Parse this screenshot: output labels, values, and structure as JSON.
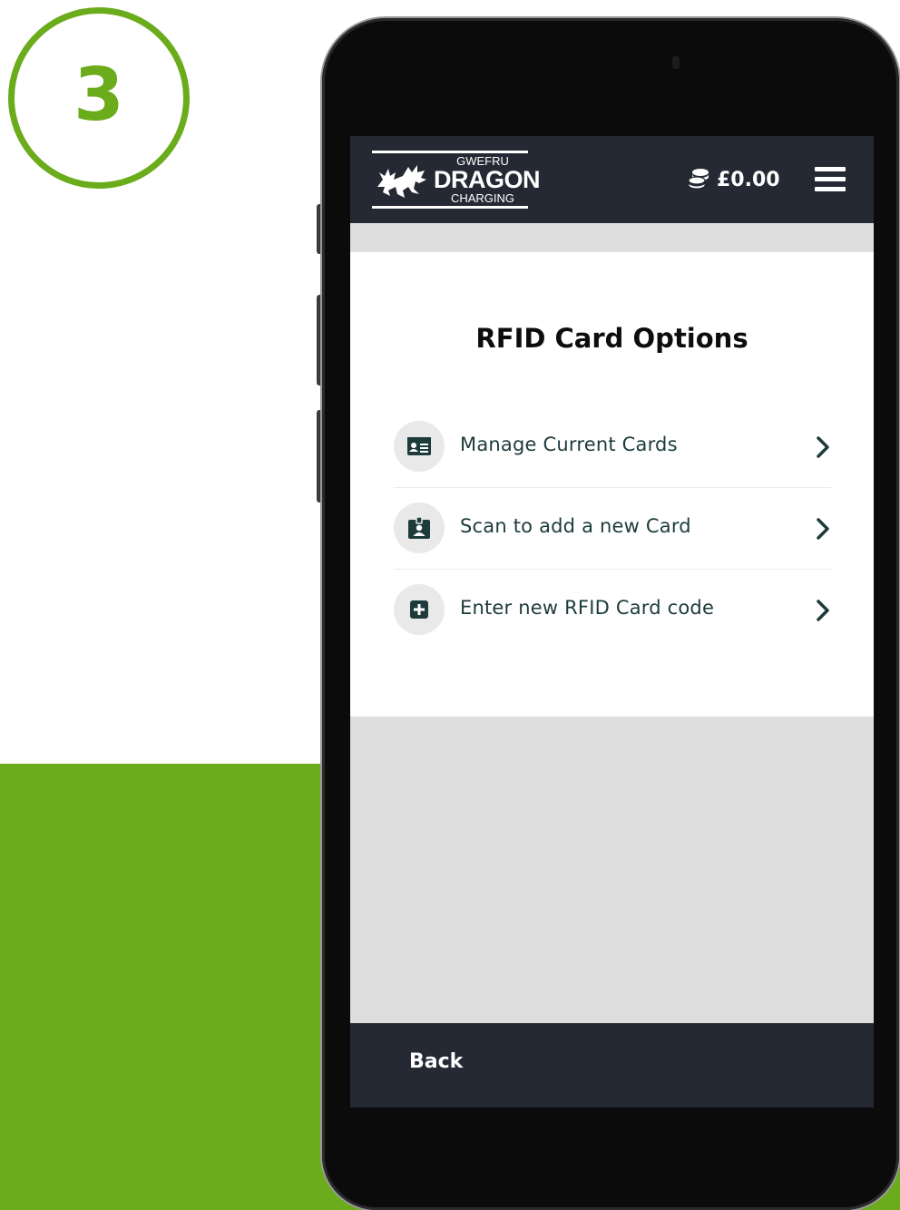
{
  "step": {
    "number": "3"
  },
  "colors": {
    "brand_green": "#6aac1b",
    "header_bg": "#252933",
    "text_dark": "#1d3b3b"
  },
  "header": {
    "logo": {
      "top": "GWEFRU",
      "main": "DRAGON",
      "bottom": "CHARGING"
    },
    "balance": "£0.00",
    "balance_icon": "coins-icon",
    "menu_icon": "hamburger-menu-icon"
  },
  "main": {
    "title": "RFID Card Options",
    "options": [
      {
        "label": "Manage Current Cards",
        "icon": "id-card-icon"
      },
      {
        "label": "Scan to add a new Card",
        "icon": "id-badge-icon"
      },
      {
        "label": "Enter new RFID Card code",
        "icon": "plus-square-icon"
      }
    ]
  },
  "footer": {
    "back_label": "Back"
  }
}
